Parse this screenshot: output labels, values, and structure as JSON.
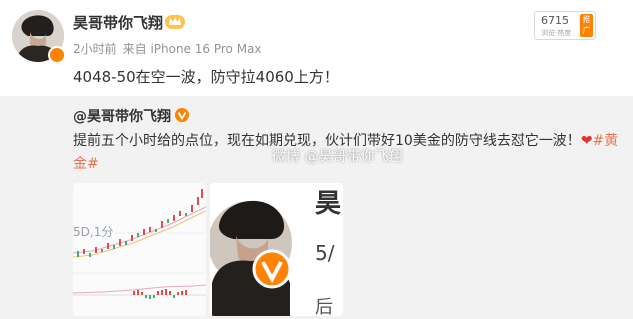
{
  "post": {
    "author": "昊哥带你飞翔",
    "time": "2小时前",
    "source": "来自 iPhone 16 Pro Max",
    "text": "4048-50在空一波，防守拉4060上方！"
  },
  "hot_rank": {
    "value": "6715",
    "label": "浏览·热度",
    "tag": "推广"
  },
  "repost": {
    "author": "@昊哥带你飞翔",
    "text": "提前五个小时给的点位，现在如期兑现，伙计们带好10美金的防守线去怼它一波！",
    "heart": "❤",
    "topic": "#黄金#",
    "watermark": "微博 @昊哥带你飞翔"
  },
  "thumbnails": {
    "chart_label": "5D,1分",
    "profile_char1": "昊",
    "profile_char2": "5/",
    "profile_char3": "后"
  },
  "colors": {
    "accent_orange": "#ff8200",
    "topic_link": "#eb7350",
    "heart_red": "#e5322d",
    "repost_bg": "#f2f2f2"
  },
  "icons": [
    "avatar-verified-icon",
    "crown-badge-icon",
    "verified-v-icon",
    "heart-icon"
  ]
}
